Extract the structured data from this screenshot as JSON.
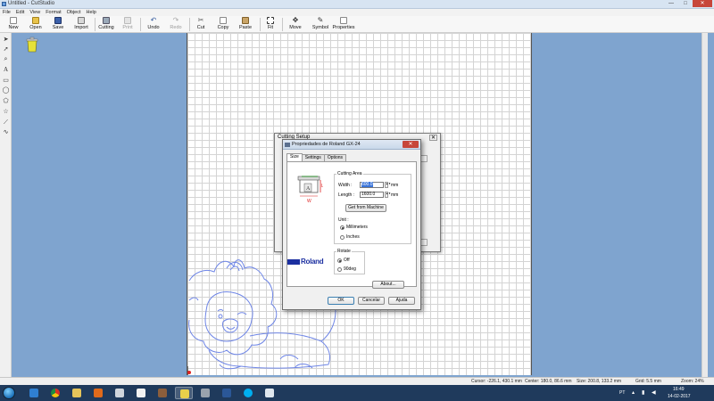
{
  "window": {
    "title": "Untitled - CutStudio",
    "min": "—",
    "max": "□",
    "close": "✕"
  },
  "menu": [
    "File",
    "Edit",
    "View",
    "Format",
    "Object",
    "Help"
  ],
  "toolbar": {
    "new": "New",
    "open": "Open",
    "save": "Save",
    "import": "Import",
    "cutting": "Cutting",
    "print": "Print",
    "undo": "Undo",
    "redo": "Redo",
    "cut": "Cut",
    "copy": "Copy",
    "paste": "Paste",
    "fit": "Fit",
    "move": "Move",
    "symbol": "Symbol",
    "properties": "Properties"
  },
  "tools": [
    "select-tool-icon",
    "node-edit-tool-icon",
    "zoom-tool-icon",
    "text-tool-icon",
    "rectangle-tool-icon",
    "ellipse-tool-icon",
    "polygon-tool-icon",
    "star-tool-icon",
    "polyline-tool-icon",
    "curve-tool-icon"
  ],
  "status": {
    "cursor": "Cursor: -226.1, 430.1 mm",
    "center": "Center: 180.0, 86.6 mm",
    "size": "Size: 200.8, 133.2 mm",
    "grid": "Grid: 5.5 mm",
    "zoom": "Zoom: 24%"
  },
  "cutting_setup": {
    "title": "Cutting Setup",
    "close": "✕"
  },
  "properties_dialog": {
    "title": "Propriedades de Roland GX-24",
    "close": "✕",
    "tabs": [
      "Size",
      "Settings",
      "Options"
    ],
    "cutting_area_label": "Cutting Area",
    "width_label": "Width :",
    "width_value": "600.0",
    "length_label": "Length :",
    "length_value": "1600.0",
    "mm": "mm",
    "get_from_machine": "Get from Machine",
    "unit_label": "Unit :",
    "unit_options": [
      "Millimeters",
      "Inches"
    ],
    "unit_selected": 0,
    "rotate_label": "Rotate",
    "rotate_options": [
      "Off",
      "90deg"
    ],
    "rotate_selected": 0,
    "brand": "Roland",
    "about": "About...",
    "ok": "OK",
    "cancel": "Cancelar",
    "help": "Ajuda",
    "device_label_w": "W",
    "device_label_l": "L"
  },
  "taskbar": {
    "lang": "PT",
    "time": "16:49",
    "date": "14-02-2017"
  },
  "colors": {
    "accent": "#3a74d9",
    "workspace": "#7fa4cf",
    "brand": "#1b2fa0",
    "lion": "#6f86e6"
  }
}
